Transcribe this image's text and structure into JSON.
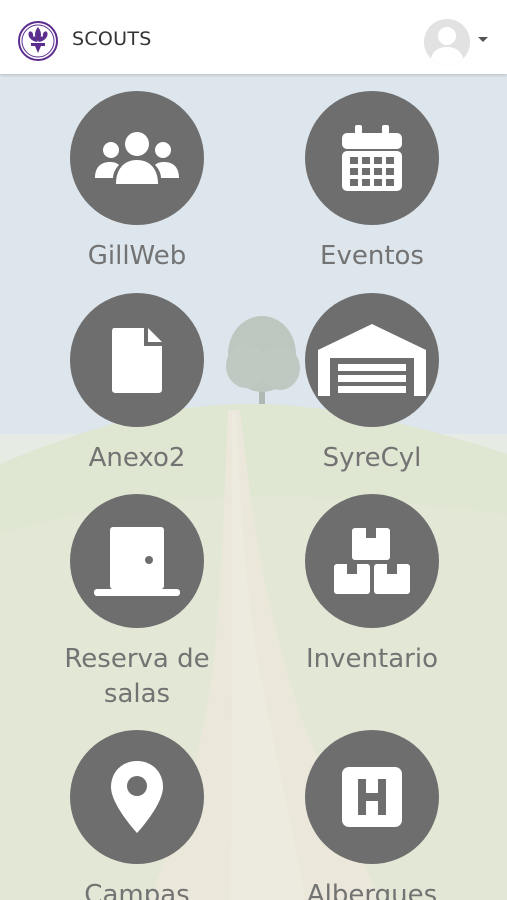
{
  "header": {
    "title": "SCOUTS",
    "logo_icon": "fleur-de-lis-icon",
    "avatar_icon": "user-avatar-icon",
    "menu_icon": "caret-down-icon"
  },
  "colors": {
    "tile_circle": "#6e6e6e",
    "tile_label": "#737373",
    "header_bg": "#ffffff",
    "logo_purple": "#5b2d8e"
  },
  "tiles": [
    {
      "label": "GillWeb",
      "icon": "users-group-icon"
    },
    {
      "label": "Eventos",
      "icon": "calendar-icon"
    },
    {
      "label": "Anexo2",
      "icon": "document-icon"
    },
    {
      "label": "SyreCyl",
      "icon": "warehouse-icon"
    },
    {
      "label": "Reserva de salas",
      "icon": "door-icon"
    },
    {
      "label": "Inventario",
      "icon": "boxes-icon"
    },
    {
      "label": "Campas",
      "icon": "map-marker-icon"
    },
    {
      "label": "Albergues",
      "icon": "hostel-h-icon"
    }
  ]
}
